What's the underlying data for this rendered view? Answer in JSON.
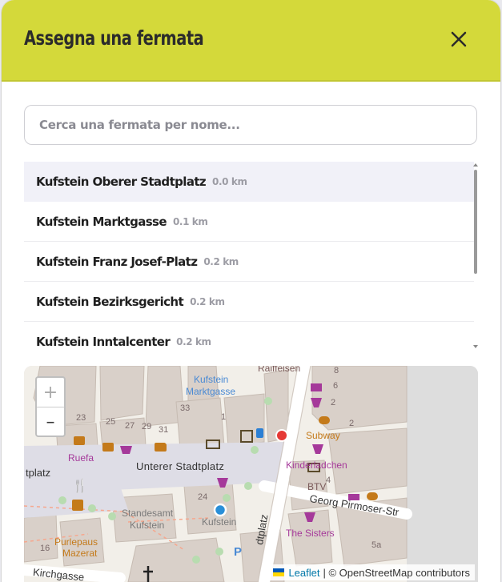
{
  "modal": {
    "title": "Assegna una fermata",
    "close_icon": "close-icon"
  },
  "search": {
    "placeholder": "Cerca una fermata per nome..."
  },
  "stops": [
    {
      "name": "Kufstein Oberer Stadtplatz",
      "distance": "0.0 km",
      "selected": true
    },
    {
      "name": "Kufstein Marktgasse",
      "distance": "0.1 km",
      "selected": false
    },
    {
      "name": "Kufstein Franz Josef-Platz",
      "distance": "0.2 km",
      "selected": false
    },
    {
      "name": "Kufstein Bezirksgericht",
      "distance": "0.2 km",
      "selected": false
    },
    {
      "name": "Kufstein Inntalcenter",
      "distance": "0.2 km",
      "selected": false
    }
  ],
  "map": {
    "zoom_in": "+",
    "zoom_out": "–",
    "attribution_link": "Leaflet",
    "attribution_text": "| © OpenStreetMap contributors",
    "labels": {
      "raiffeisen": "Raiffeisen",
      "kufstein_marktgasse": "Kufstein",
      "marktgasse": "Marktgasse",
      "subway": "Subway",
      "ruefa": "Ruefa",
      "unterer_stadtplatz": "Unterer Stadtplatz",
      "platz": "tplatz",
      "kinderladchen": "Kinderladchen",
      "btv": "BTV",
      "georg": "Georg Pirmoser-Str",
      "standesamt": "Standesamt",
      "standesamt_kufstein": "Kufstein",
      "kufstein": "Kufstein",
      "the_sisters": "The Sisters",
      "purlepaus": "Purlepaus",
      "mazerat": "Mazerat",
      "kirchgasse": "Kirchgasse",
      "dtplatz": "dtplatz",
      "house_numbers": [
        "8",
        "6",
        "2",
        "2",
        "33",
        "1",
        "23",
        "25",
        "27",
        "29",
        "31",
        "4",
        "24",
        "16",
        "5a"
      ]
    },
    "colors": {
      "selected_marker": "#e53935",
      "user_marker": "#2a8fd8"
    }
  },
  "colors": {
    "header": "#d4d93a",
    "selected_row": "#f1f1f8"
  }
}
